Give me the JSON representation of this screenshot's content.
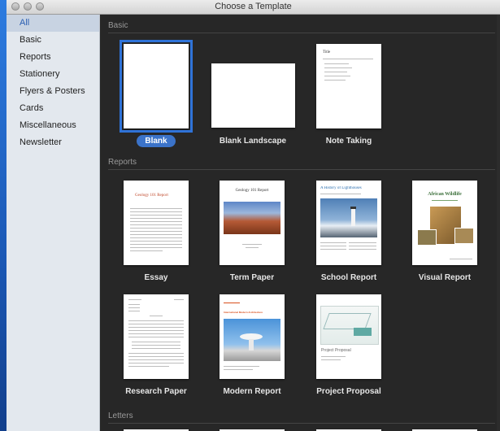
{
  "window": {
    "title": "Choose a Template"
  },
  "sidebar": {
    "items": [
      {
        "label": "All",
        "active": true
      },
      {
        "label": "Basic"
      },
      {
        "label": "Reports"
      },
      {
        "label": "Stationery"
      },
      {
        "label": "Flyers & Posters"
      },
      {
        "label": "Cards"
      },
      {
        "label": "Miscellaneous"
      },
      {
        "label": "Newsletter"
      }
    ]
  },
  "sections": {
    "basic": {
      "title": "Basic",
      "templates": [
        {
          "label": "Blank"
        },
        {
          "label": "Blank Landscape"
        },
        {
          "label": "Note Taking",
          "preview_title": "Title"
        }
      ]
    },
    "reports": {
      "title": "Reports",
      "templates": [
        {
          "label": "Essay",
          "preview_title": "Geology 101 Report"
        },
        {
          "label": "Term Paper",
          "preview_title": "Geology 101 Report"
        },
        {
          "label": "School Report",
          "preview_title": "A History of Lighthouses"
        },
        {
          "label": "Visual Report",
          "preview_title": "African Wildlife"
        },
        {
          "label": "Research Paper"
        },
        {
          "label": "Modern Report",
          "preview_title": "International Modern Architecture"
        },
        {
          "label": "Project Proposal",
          "preview_title": "Project Proposal"
        }
      ]
    },
    "letters": {
      "title": "Letters"
    }
  },
  "colors": {
    "accent": "#2f73d8",
    "background": "#272727",
    "sidebar": "#e3e8ee"
  }
}
